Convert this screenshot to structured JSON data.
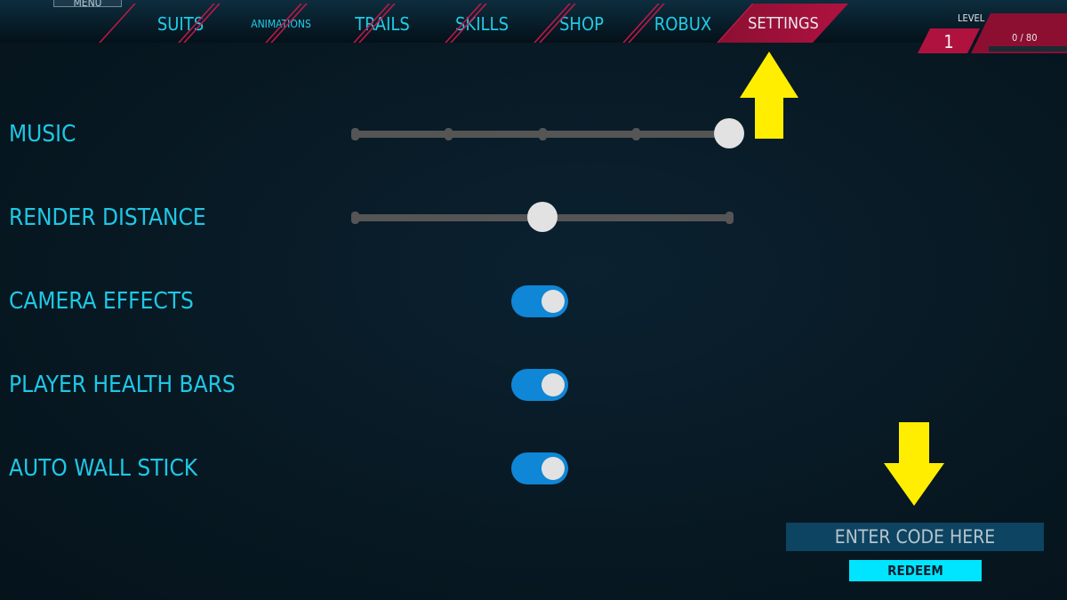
{
  "menu_button": "MENU",
  "tabs": [
    {
      "label": "SUITS",
      "active": false
    },
    {
      "label": "ANIMATIONS",
      "active": false
    },
    {
      "label": "TRAILS",
      "active": false
    },
    {
      "label": "SKILLS",
      "active": false
    },
    {
      "label": "SHOP",
      "active": false
    },
    {
      "label": "ROBUX",
      "active": false
    },
    {
      "label": "SETTINGS",
      "active": true
    }
  ],
  "level": {
    "label": "LEVEL",
    "value": "1",
    "xp": "0 / 80",
    "xp_fraction": 0
  },
  "settings": {
    "music": {
      "label": "MUSIC",
      "value": 1.0,
      "steps": 4
    },
    "render_distance": {
      "label": "RENDER DISTANCE",
      "value": 0.5
    },
    "camera_effects": {
      "label": "CAMERA EFFECTS",
      "on": true
    },
    "player_health_bars": {
      "label": "PLAYER HEALTH BARS",
      "on": true
    },
    "auto_wall_stick": {
      "label": "AUTO WALL STICK",
      "on": true
    }
  },
  "code": {
    "placeholder": "ENTER CODE HERE",
    "redeem_label": "REDEEM"
  },
  "colors": {
    "accent": "#1ec8e6",
    "active_tab": "#b01240",
    "toggle_on": "#0f86d6",
    "redeem": "#00e5ff",
    "annotation_arrow": "#ffee00"
  }
}
